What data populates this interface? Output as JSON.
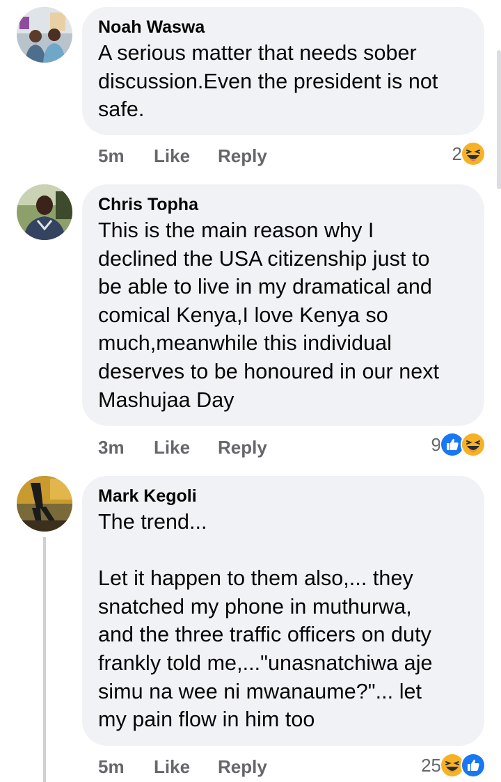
{
  "comments": [
    {
      "author": "Noah Waswa",
      "text": "A serious matter that needs sober\ndiscussion.Even the president is not\nsafe.",
      "time": "5m",
      "like_label": "Like",
      "reply_label": "Reply",
      "reaction_count": "2",
      "reactions": [
        "haha-icon"
      ]
    },
    {
      "author": "Chris Topha",
      "text": "This is the main reason why I\ndeclined the USA citizenship just to\nbe able to live in my dramatical and\ncomical Kenya,I love Kenya so\nmuch,meanwhile this individual\ndeserves to be honoured in our next\nMashujaa Day",
      "time": "3m",
      "like_label": "Like",
      "reply_label": "Reply",
      "reaction_count": "9",
      "reactions": [
        "like-icon",
        "haha-icon"
      ]
    },
    {
      "author": "Mark Kegoli",
      "text": "The trend...\n\nLet it happen to them also,... they\nsnatched my phone in muthurwa,\nand the three traffic officers on duty\nfrankly told me,...\"unasnatchiwa aje\nsimu na wee ni mwanaume?\"...  let\nmy pain flow in him too",
      "time": "5m",
      "like_label": "Like",
      "reply_label": "Reply",
      "reaction_count": "25",
      "reactions": [
        "haha-icon",
        "like-icon"
      ]
    }
  ],
  "colors": {
    "bubble": "#f0f2f5",
    "meta_text": "#65676b",
    "like_blue": "#1877f2",
    "haha_yellow": "#f7b125"
  }
}
